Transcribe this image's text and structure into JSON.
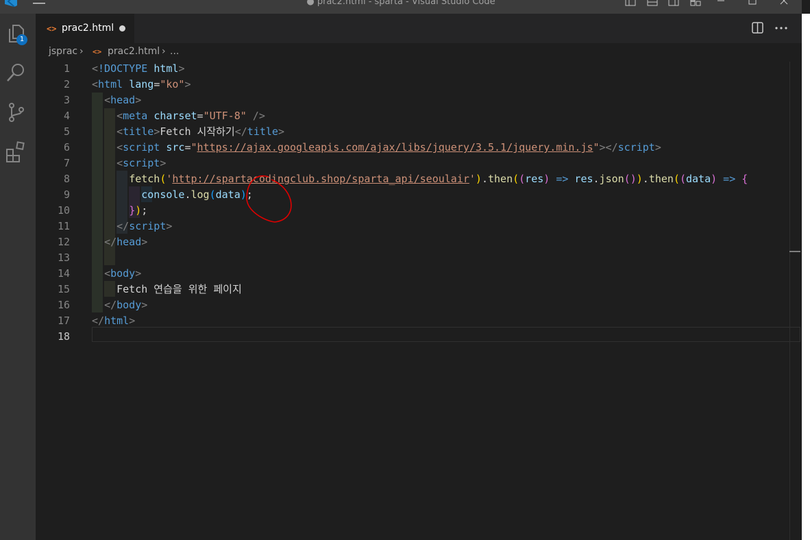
{
  "window": {
    "title": "● prac2.html - sparta - Visual Studio Code"
  },
  "activity_bar": {
    "explorer_badge": "1"
  },
  "tab": {
    "label": "prac2.html"
  },
  "breadcrumb": {
    "folder": "jsprac",
    "file": "prac2.html",
    "more": "..."
  },
  "editor": {
    "active_line": 18,
    "lines": [
      {
        "n": "1",
        "tokens": [
          {
            "t": "<",
            "c": "t"
          },
          {
            "t": "!DOCTYPE",
            "c": "tag"
          },
          {
            "t": " ",
            "c": "txt"
          },
          {
            "t": "html",
            "c": "attr"
          },
          {
            "t": ">",
            "c": "t"
          }
        ]
      },
      {
        "n": "2",
        "tokens": [
          {
            "t": "<",
            "c": "t"
          },
          {
            "t": "html",
            "c": "tag"
          },
          {
            "t": " ",
            "c": "txt"
          },
          {
            "t": "lang",
            "c": "attr"
          },
          {
            "t": "=",
            "c": "txt"
          },
          {
            "t": "\"ko\"",
            "c": "str"
          },
          {
            "t": ">",
            "c": "t"
          }
        ]
      },
      {
        "n": "3",
        "tokens": [
          {
            "t": "  ",
            "c": "txt"
          },
          {
            "t": "<",
            "c": "t"
          },
          {
            "t": "head",
            "c": "tag"
          },
          {
            "t": ">",
            "c": "t"
          }
        ]
      },
      {
        "n": "4",
        "tokens": [
          {
            "t": "    ",
            "c": "txt"
          },
          {
            "t": "<",
            "c": "t"
          },
          {
            "t": "meta",
            "c": "tag"
          },
          {
            "t": " ",
            "c": "txt"
          },
          {
            "t": "charset",
            "c": "attr"
          },
          {
            "t": "=",
            "c": "txt"
          },
          {
            "t": "\"UTF-8\"",
            "c": "str"
          },
          {
            "t": " />",
            "c": "t"
          }
        ]
      },
      {
        "n": "5",
        "tokens": [
          {
            "t": "    ",
            "c": "txt"
          },
          {
            "t": "<",
            "c": "t"
          },
          {
            "t": "title",
            "c": "tag"
          },
          {
            "t": ">",
            "c": "t"
          },
          {
            "t": "Fetch 시작하기",
            "c": "txt"
          },
          {
            "t": "</",
            "c": "t"
          },
          {
            "t": "title",
            "c": "tag"
          },
          {
            "t": ">",
            "c": "t"
          }
        ]
      },
      {
        "n": "6",
        "tokens": [
          {
            "t": "    ",
            "c": "txt"
          },
          {
            "t": "<",
            "c": "t"
          },
          {
            "t": "script",
            "c": "tag"
          },
          {
            "t": " ",
            "c": "txt"
          },
          {
            "t": "src",
            "c": "attr"
          },
          {
            "t": "=",
            "c": "txt"
          },
          {
            "t": "\"",
            "c": "str"
          },
          {
            "t": "https://ajax.googleapis.com/ajax/libs/jquery/3.5.1/jquery.min.js",
            "c": "str u"
          },
          {
            "t": "\"",
            "c": "str"
          },
          {
            "t": "></",
            "c": "t"
          },
          {
            "t": "script",
            "c": "tag"
          },
          {
            "t": ">",
            "c": "t"
          }
        ]
      },
      {
        "n": "7",
        "tokens": [
          {
            "t": "    ",
            "c": "txt"
          },
          {
            "t": "<",
            "c": "t"
          },
          {
            "t": "script",
            "c": "tag"
          },
          {
            "t": ">",
            "c": "t"
          }
        ]
      },
      {
        "n": "8",
        "tokens": [
          {
            "t": "      ",
            "c": "txt"
          },
          {
            "t": "fetch",
            "c": "fn"
          },
          {
            "t": "(",
            "c": "yb"
          },
          {
            "t": "'",
            "c": "str"
          },
          {
            "t": "http://spartacodingclub.shop/sparta_api/seoulair",
            "c": "str u"
          },
          {
            "t": "'",
            "c": "str"
          },
          {
            "t": ")",
            "c": "yb"
          },
          {
            "t": ".",
            "c": "txt"
          },
          {
            "t": "then",
            "c": "fn"
          },
          {
            "t": "(",
            "c": "yb"
          },
          {
            "t": "(",
            "c": "pb"
          },
          {
            "t": "res",
            "c": "var"
          },
          {
            "t": ")",
            "c": "pb"
          },
          {
            "t": " ",
            "c": "txt"
          },
          {
            "t": "=>",
            "c": "op"
          },
          {
            "t": " ",
            "c": "txt"
          },
          {
            "t": "res",
            "c": "var"
          },
          {
            "t": ".",
            "c": "txt"
          },
          {
            "t": "json",
            "c": "fn"
          },
          {
            "t": "(",
            "c": "pb"
          },
          {
            "t": ")",
            "c": "pb"
          },
          {
            "t": ")",
            "c": "yb"
          },
          {
            "t": ".",
            "c": "txt"
          },
          {
            "t": "then",
            "c": "fn"
          },
          {
            "t": "(",
            "c": "yb"
          },
          {
            "t": "(",
            "c": "pb"
          },
          {
            "t": "data",
            "c": "var"
          },
          {
            "t": ")",
            "c": "pb"
          },
          {
            "t": " ",
            "c": "txt"
          },
          {
            "t": "=>",
            "c": "op"
          },
          {
            "t": " ",
            "c": "txt"
          },
          {
            "t": "{",
            "c": "pb"
          }
        ]
      },
      {
        "n": "9",
        "tokens": [
          {
            "t": "        ",
            "c": "txt"
          },
          {
            "t": "console",
            "c": "var"
          },
          {
            "t": ".",
            "c": "txt"
          },
          {
            "t": "log",
            "c": "fn"
          },
          {
            "t": "(",
            "c": "bb"
          },
          {
            "t": "data",
            "c": "var"
          },
          {
            "t": ")",
            "c": "bb"
          },
          {
            "t": ";",
            "c": "txt"
          }
        ]
      },
      {
        "n": "10",
        "tokens": [
          {
            "t": "      ",
            "c": "txt"
          },
          {
            "t": "}",
            "c": "pb"
          },
          {
            "t": ")",
            "c": "yb"
          },
          {
            "t": ";",
            "c": "txt"
          }
        ]
      },
      {
        "n": "11",
        "tokens": [
          {
            "t": "    ",
            "c": "txt"
          },
          {
            "t": "</",
            "c": "t"
          },
          {
            "t": "script",
            "c": "tag"
          },
          {
            "t": ">",
            "c": "t"
          }
        ]
      },
      {
        "n": "12",
        "tokens": [
          {
            "t": "  ",
            "c": "txt"
          },
          {
            "t": "</",
            "c": "t"
          },
          {
            "t": "head",
            "c": "tag"
          },
          {
            "t": ">",
            "c": "t"
          }
        ]
      },
      {
        "n": "13",
        "tokens": []
      },
      {
        "n": "14",
        "tokens": [
          {
            "t": "  ",
            "c": "txt"
          },
          {
            "t": "<",
            "c": "t"
          },
          {
            "t": "body",
            "c": "tag"
          },
          {
            "t": ">",
            "c": "t"
          }
        ]
      },
      {
        "n": "15",
        "tokens": [
          {
            "t": "    ",
            "c": "txt"
          },
          {
            "t": "Fetch 연습을 위한 페이지",
            "c": "txt"
          }
        ]
      },
      {
        "n": "16",
        "tokens": [
          {
            "t": "  ",
            "c": "txt"
          },
          {
            "t": "</",
            "c": "t"
          },
          {
            "t": "body",
            "c": "tag"
          },
          {
            "t": ">",
            "c": "t"
          }
        ]
      },
      {
        "n": "17",
        "tokens": [
          {
            "t": "</",
            "c": "t"
          },
          {
            "t": "html",
            "c": "tag"
          },
          {
            "t": ">",
            "c": "t"
          }
        ]
      },
      {
        "n": "18",
        "tokens": []
      }
    ]
  },
  "colors": {
    "accent": "#0e70c0",
    "annotation": "#e00000"
  }
}
